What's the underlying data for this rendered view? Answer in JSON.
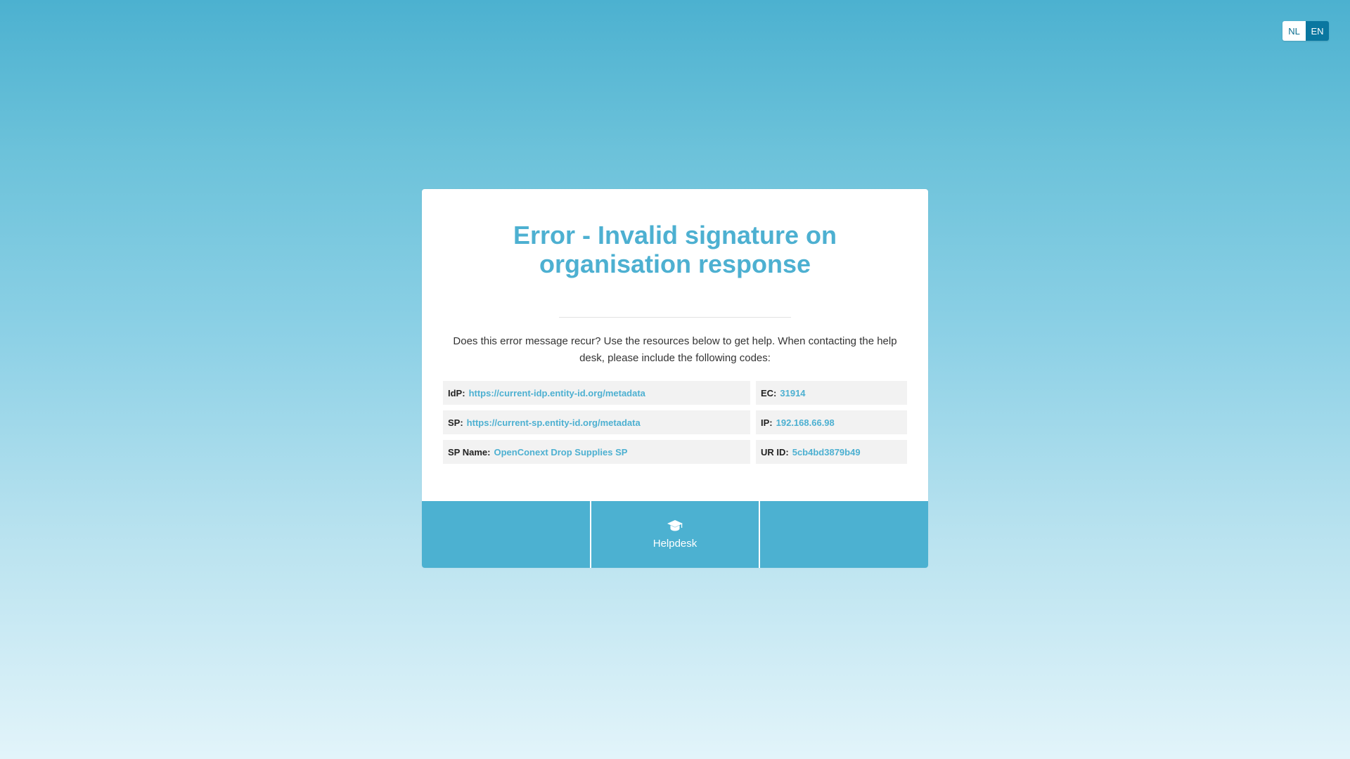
{
  "language_switch": {
    "options": [
      {
        "label": "NL",
        "active": false
      },
      {
        "label": "EN",
        "active": true
      }
    ]
  },
  "error": {
    "title": "Error - Invalid signature on organisation response",
    "intro": "Does this error message recur? Use the resources below to get help. When contacting the help desk, please include the following codes:"
  },
  "codes": {
    "idp": {
      "label": "IdP:",
      "value": "https://current-idp.entity-id.org/metadata"
    },
    "ec": {
      "label": "EC:",
      "value": "31914"
    },
    "sp": {
      "label": "SP:",
      "value": "https://current-sp.entity-id.org/metadata"
    },
    "ip": {
      "label": "IP:",
      "value": "192.168.66.98"
    },
    "sp_name": {
      "label": "SP Name:",
      "value": "OpenConext Drop Supplies SP"
    },
    "ur_id": {
      "label": "UR ID:",
      "value": "5cb4bd3879b49"
    }
  },
  "footer": {
    "helpdesk_label": "Helpdesk",
    "helpdesk_icon": "graduation-cap-icon"
  },
  "colors": {
    "accent": "#4db0d1",
    "active_lang": "#0a77a0",
    "code_bg": "#f2f2f2"
  }
}
